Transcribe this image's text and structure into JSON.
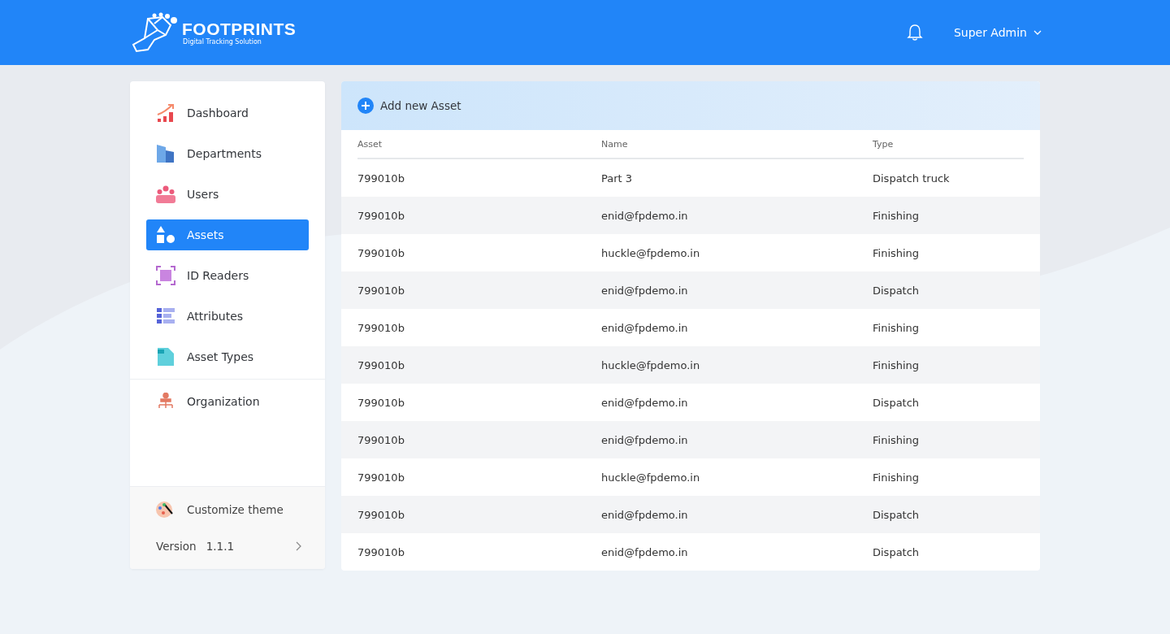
{
  "header": {
    "brand": "FOOTPRINTS",
    "tagline": "Digital Tracking Solution",
    "user": "Super Admin"
  },
  "sidebar": {
    "items": [
      {
        "label": "Dashboard",
        "selected": false
      },
      {
        "label": "Departments",
        "selected": false
      },
      {
        "label": "Users",
        "selected": false
      },
      {
        "label": "Assets",
        "selected": true
      },
      {
        "label": "ID Readers",
        "selected": false
      },
      {
        "label": "Attributes",
        "selected": false
      },
      {
        "label": "Asset Types",
        "selected": false
      }
    ],
    "secondary_items": [
      {
        "label": "Organization",
        "selected": false
      }
    ],
    "customize": "Customize theme",
    "version_label": "Version",
    "version": "1.1.1"
  },
  "main": {
    "add_button": "Add new Asset",
    "table": {
      "columns": [
        "Asset",
        "Name",
        "Type"
      ],
      "rows": [
        [
          "799010b",
          "Part 3",
          "Dispatch truck"
        ],
        [
          "799010b",
          "enid@fpdemo.in",
          "Finishing"
        ],
        [
          "799010b",
          "huckle@fpdemo.in",
          "Finishing"
        ],
        [
          "799010b",
          "enid@fpdemo.in",
          "Dispatch"
        ],
        [
          "799010b",
          "enid@fpdemo.in",
          "Finishing"
        ],
        [
          "799010b",
          "huckle@fpdemo.in",
          "Finishing"
        ],
        [
          "799010b",
          "enid@fpdemo.in",
          "Dispatch"
        ],
        [
          "799010b",
          "enid@fpdemo.in",
          "Finishing"
        ],
        [
          "799010b",
          "huckle@fpdemo.in",
          "Finishing"
        ],
        [
          "799010b",
          "enid@fpdemo.in",
          "Dispatch"
        ],
        [
          "799010b",
          "enid@fpdemo.in",
          "Dispatch"
        ]
      ]
    }
  }
}
